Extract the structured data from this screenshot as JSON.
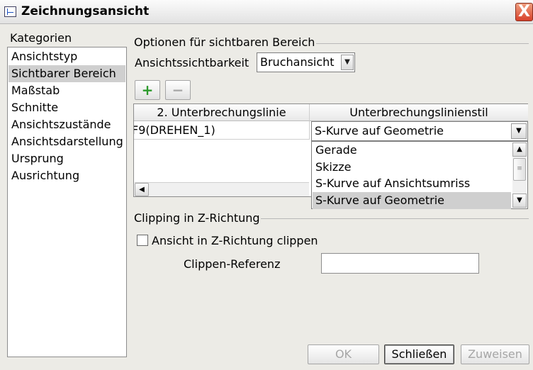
{
  "window": {
    "title": "Zeichnungsansicht",
    "close_symbol": "X"
  },
  "categories": {
    "label": "Kategorien",
    "items": [
      {
        "label": "Ansichtstyp"
      },
      {
        "label": "Sichtbarer Bereich",
        "selected": true
      },
      {
        "label": "Maßstab"
      },
      {
        "label": "Schnitte"
      },
      {
        "label": "Ansichtszustände"
      },
      {
        "label": "Ansichtsdarstellung"
      },
      {
        "label": "Ursprung"
      },
      {
        "label": "Ausrichtung"
      }
    ]
  },
  "visible_area": {
    "heading": "Optionen für sichtbaren Bereich",
    "visibility_label": "Ansichtssichtbarkeit",
    "visibility_value": "Bruchansicht",
    "add_symbol": "+",
    "remove_symbol": "−"
  },
  "table": {
    "columns": [
      "2. Unterbrechungslinie",
      "Unterbrechungslinienstil"
    ],
    "rows": [
      {
        "line": "F9(DREHEN_1)",
        "style": "S-Kurve auf Geometrie"
      }
    ]
  },
  "style_dropdown": {
    "options": [
      "Gerade",
      "Skizze",
      "S-Kurve auf Ansichtsumriss",
      "S-Kurve auf Geometrie"
    ],
    "selected_index": 3
  },
  "clipping": {
    "heading": "Clipping in Z-Richtung",
    "checkbox_label": "Ansicht in Z-Richtung clippen",
    "checked": false,
    "reference_label": "Clippen-Referenz",
    "reference_value": ""
  },
  "buttons": {
    "ok": "OK",
    "close": "Schließen",
    "apply": "Zuweisen"
  },
  "icons": {
    "window": "drawing-view-icon",
    "close": "close-icon",
    "add": "plus-icon",
    "remove": "minus-icon",
    "dropdown": "chevron-down-icon",
    "scroll_left": "chevron-left-icon",
    "scroll_up": "chevron-up-icon"
  },
  "colors": {
    "selection": "#cfcfcf",
    "add_icon": "#2c9a2c",
    "close_button": "#d8402a"
  }
}
